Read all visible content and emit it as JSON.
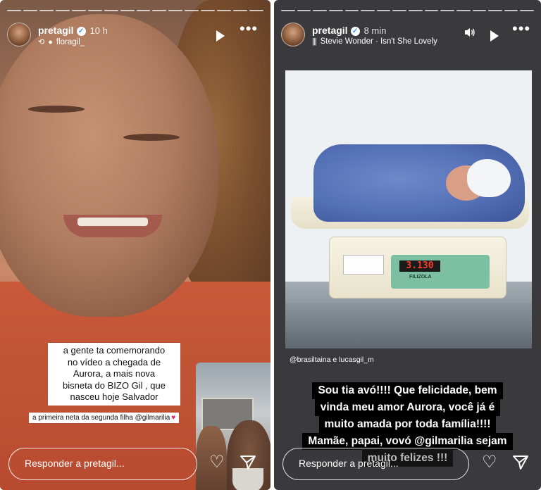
{
  "left_story": {
    "username": "pretagil",
    "time": "10 h",
    "repost_from": "floragil_",
    "caption_lines": [
      "a gente ta comemorando",
      "no vídeo a chegada de",
      "Aurora, a mais nova",
      "bisneta do BIZO Gil , que",
      "nasceu hoje Salvador"
    ],
    "sub_caption": "a primeira neta da segunda filha @gilmarilia",
    "reply_placeholder": "Responder a pretagil..."
  },
  "right_story": {
    "username": "pretagil",
    "time": "8 min",
    "song": "Stevie Wonder · Isn't She Lovely",
    "scale_display": "3.130",
    "scale_brand": "FILIZOLA",
    "credit": "@brasiltaina e lucasgil_m",
    "caption_lines": [
      "Sou tia avó!!!! Que felicidade, bem",
      "vinda meu amor Aurora, você já é",
      "muito amada por toda família!!!!",
      "Mamãe, papai, vovó @gilmarilia sejam",
      "muito felizes !!!"
    ],
    "reply_placeholder": "Responder a pretagil..."
  },
  "icons": {
    "verified": "verified-badge-icon",
    "play": "play-icon",
    "more": "more-icon",
    "heart": "heart-icon",
    "send": "send-icon",
    "volume": "volume-icon"
  },
  "colors": {
    "verified_blue": "#3897f0",
    "caption_bg_right": "#000000",
    "caption_bg_left": "#ffffff"
  }
}
